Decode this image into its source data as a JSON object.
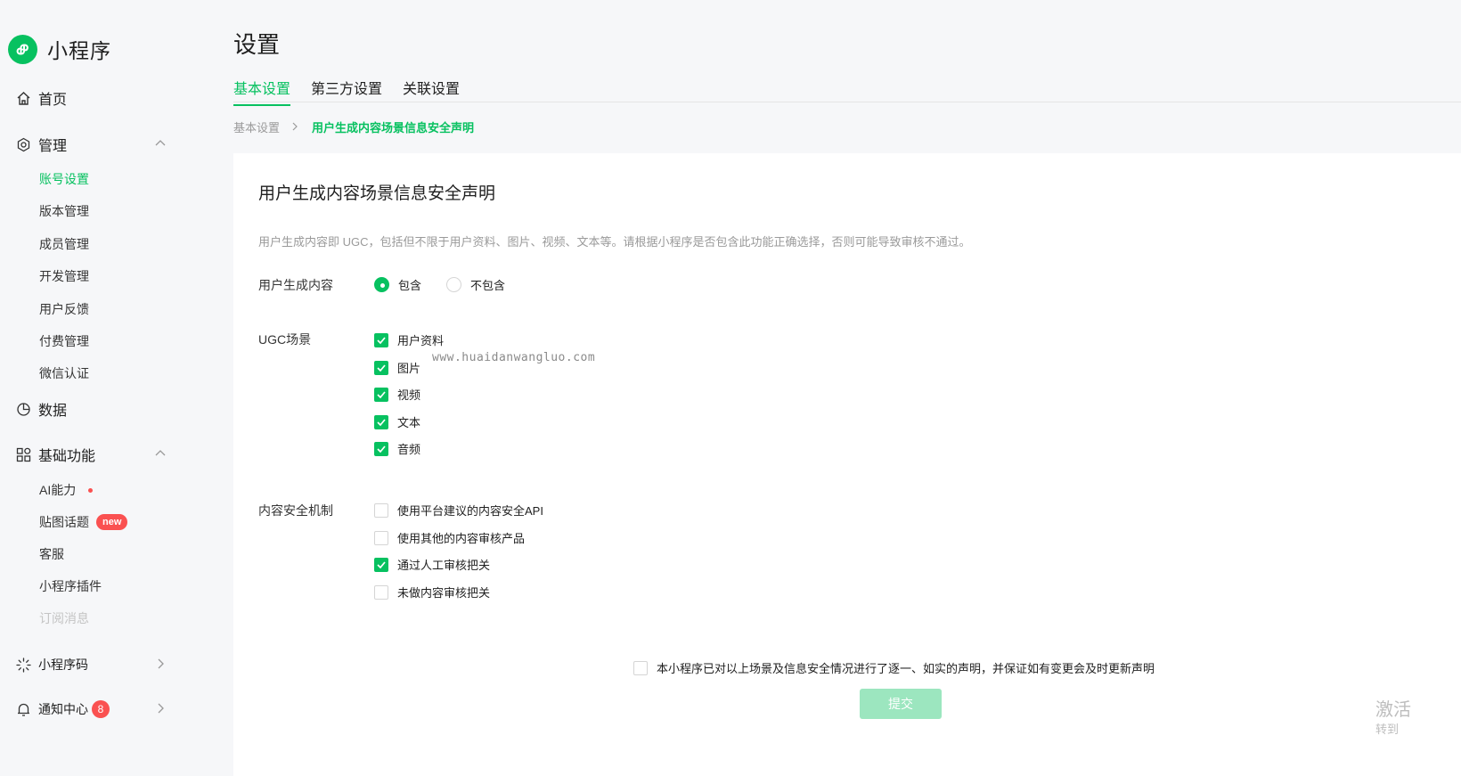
{
  "brand": {
    "name": "小程序",
    "accent": "#07c160"
  },
  "sidebar": {
    "home": "首页",
    "manage": "管理",
    "manage_items": [
      "账号设置",
      "版本管理",
      "成员管理",
      "开发管理",
      "用户反馈",
      "付费管理",
      "微信认证"
    ],
    "data": "数据",
    "basic": "基础功能",
    "basic_items": [
      "AI能力",
      "贴图话题",
      "客服",
      "小程序插件",
      "订阅消息"
    ],
    "new_badge": "new",
    "qrcode": "小程序码",
    "notify": "通知中心",
    "notify_count": "8"
  },
  "header": {
    "title": "设置",
    "tabs": [
      "基本设置",
      "第三方设置",
      "关联设置"
    ]
  },
  "breadcrumb": {
    "parent": "基本设置",
    "current": "用户生成内容场景信息安全声明"
  },
  "form": {
    "title": "用户生成内容场景信息安全声明",
    "description": "用户生成内容即 UGC，包括但不限于用户资料、图片、视频、文本等。请根据小程序是否包含此功能正确选择，否则可能导致审核不通过。",
    "ugc_label": "用户生成内容",
    "ugc_options": [
      "包含",
      "不包含"
    ],
    "ugc_selected": "包含",
    "scene_label": "UGC场景",
    "scenes": [
      {
        "label": "用户资料",
        "checked": true
      },
      {
        "label": "图片",
        "checked": true
      },
      {
        "label": "视频",
        "checked": true
      },
      {
        "label": "文本",
        "checked": true
      },
      {
        "label": "音频",
        "checked": true
      }
    ],
    "safety_label": "内容安全机制",
    "safety": [
      {
        "label": "使用平台建议的内容安全API",
        "checked": false
      },
      {
        "label": "使用其他的内容审核产品",
        "checked": false
      },
      {
        "label": "通过人工审核把关",
        "checked": true
      },
      {
        "label": "未做内容审核把关",
        "checked": false
      }
    ],
    "agree_text": "本小程序已对以上场景及信息安全情况进行了逐一、如实的声明，并保证如有变更会及时更新声明",
    "submit_label": "提交"
  },
  "watermark": "www.huaidanwangluo.com",
  "activate": {
    "line1": "激活",
    "line2": "转到"
  }
}
